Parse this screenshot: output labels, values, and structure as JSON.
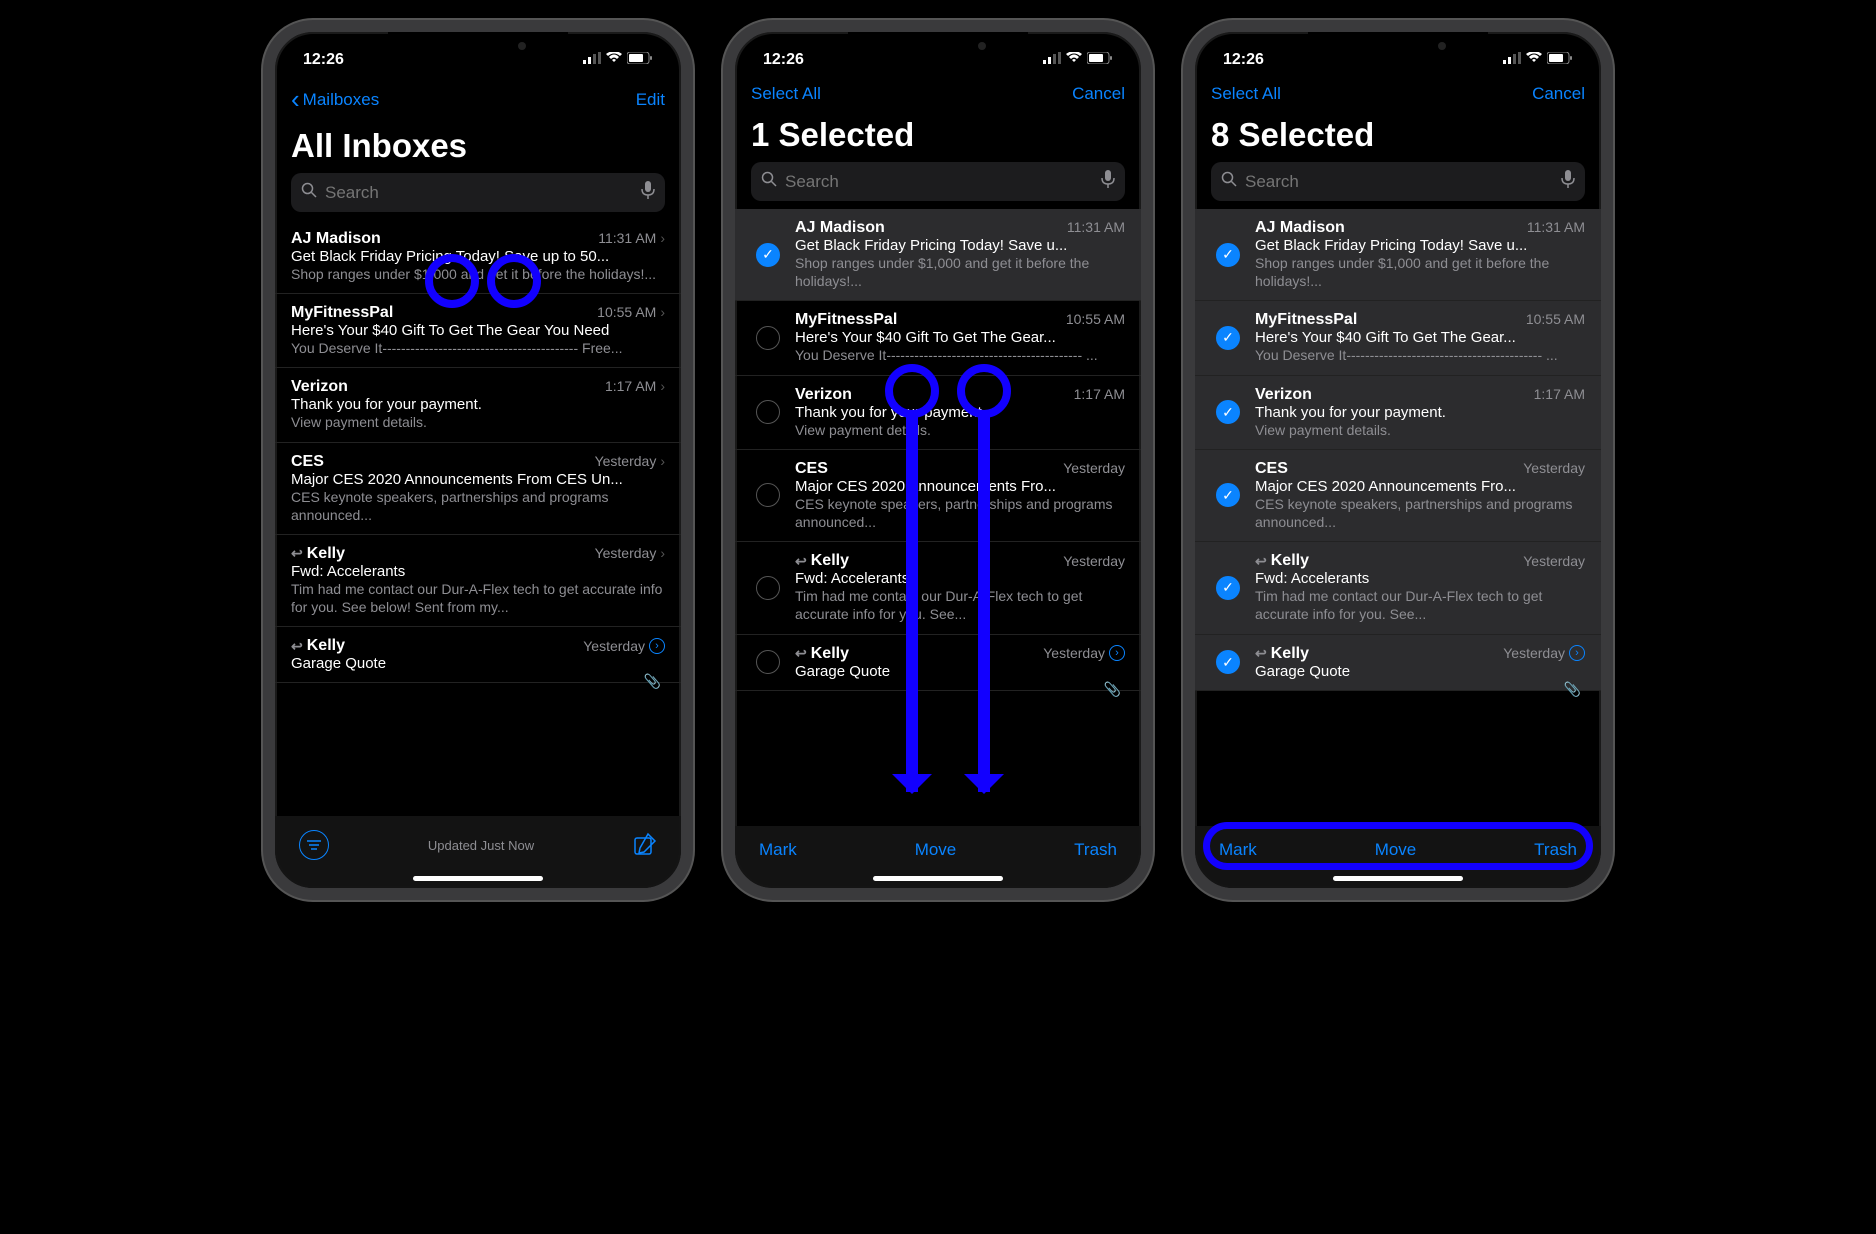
{
  "time": "12:26",
  "screens": [
    {
      "nav": {
        "left_icon": "‹",
        "left_label": "Mailboxes",
        "right_label": "Edit"
      },
      "title": "All Inboxes",
      "search_placeholder": "Search",
      "show_checkboxes": false,
      "rows": [
        {
          "sender": "AJ Madison",
          "time": "11:31 AM",
          "chevron": true,
          "subject": "Get Black Friday Pricing Today! Save up to 50...",
          "preview": "Shop ranges under $1,000 and get it before the holidays!..."
        },
        {
          "sender": "MyFitnessPal",
          "time": "10:55 AM",
          "chevron": true,
          "subject": "Here's Your $40 Gift To Get The Gear You Need",
          "preview": "You Deserve It------------------------------------------ Free..."
        },
        {
          "sender": "Verizon",
          "time": "1:17 AM",
          "chevron": true,
          "subject": "Thank you for your payment.",
          "preview": "View payment details."
        },
        {
          "sender": "CES",
          "time": "Yesterday",
          "chevron": true,
          "subject": "Major CES 2020 Announcements From CES Un...",
          "preview": "CES keynote speakers, partnerships and programs announced..."
        },
        {
          "sender": "Kelly",
          "reply": true,
          "time": "Yesterday",
          "chevron": true,
          "subject": "Fwd: Accelerants",
          "preview": "Tim had me contact our Dur-A-Flex tech to get accurate info for you. See below! Sent from my..."
        },
        {
          "sender": "Kelly",
          "reply": true,
          "time": "Yesterday",
          "thread": true,
          "attach": true,
          "subject": "Garage Quote",
          "preview": ""
        }
      ],
      "toolbar": {
        "type": "status",
        "status_label": "Updated Just Now"
      }
    },
    {
      "nav": {
        "left_label": "Select All",
        "right_label": "Cancel"
      },
      "title": "1 Selected",
      "search_placeholder": "Search",
      "show_checkboxes": true,
      "rows": [
        {
          "checked": true,
          "sender": "AJ Madison",
          "time": "11:31 AM",
          "subject": "Get Black Friday Pricing Today! Save u...",
          "preview": "Shop ranges under $1,000 and get it before the holidays!..."
        },
        {
          "checked": false,
          "sender": "MyFitnessPal",
          "time": "10:55 AM",
          "subject": "Here's Your $40 Gift To Get The Gear...",
          "preview": "You Deserve It------------------------------------------ ..."
        },
        {
          "checked": false,
          "sender": "Verizon",
          "time": "1:17 AM",
          "subject": "Thank you for your payment.",
          "preview": "View payment details."
        },
        {
          "checked": false,
          "sender": "CES",
          "time": "Yesterday",
          "subject": "Major CES 2020 Announcements Fro...",
          "preview": "CES keynote speakers, partnerships and programs announced..."
        },
        {
          "checked": false,
          "sender": "Kelly",
          "reply": true,
          "time": "Yesterday",
          "subject": "Fwd: Accelerants",
          "preview": "Tim had me contact our Dur-A-Flex tech to get accurate info for you. See..."
        },
        {
          "sender": "Kelly",
          "reply": true,
          "time": "Yesterday",
          "thread": true,
          "attach": true,
          "subject": "Garage Quote",
          "preview": ""
        }
      ],
      "toolbar": {
        "type": "actions",
        "left": "Mark",
        "center": "Move",
        "right": "Trash"
      }
    },
    {
      "nav": {
        "left_label": "Select All",
        "right_label": "Cancel"
      },
      "title": "8 Selected",
      "search_placeholder": "Search",
      "show_checkboxes": true,
      "rows": [
        {
          "checked": true,
          "sender": "AJ Madison",
          "time": "11:31 AM",
          "subject": "Get Black Friday Pricing Today! Save u...",
          "preview": "Shop ranges under $1,000 and get it before the holidays!..."
        },
        {
          "checked": true,
          "sender": "MyFitnessPal",
          "time": "10:55 AM",
          "subject": "Here's Your $40 Gift To Get The Gear...",
          "preview": "You Deserve It------------------------------------------ ..."
        },
        {
          "checked": true,
          "sender": "Verizon",
          "time": "1:17 AM",
          "subject": "Thank you for your payment.",
          "preview": "View payment details."
        },
        {
          "checked": true,
          "sender": "CES",
          "time": "Yesterday",
          "subject": "Major CES 2020 Announcements Fro...",
          "preview": "CES keynote speakers, partnerships and programs announced..."
        },
        {
          "checked": true,
          "sender": "Kelly",
          "reply": true,
          "time": "Yesterday",
          "subject": "Fwd: Accelerants",
          "preview": "Tim had me contact our Dur-A-Flex tech to get accurate info for you. See..."
        },
        {
          "checked": true,
          "sender": "Kelly",
          "reply": true,
          "time": "Yesterday",
          "thread": true,
          "attach": true,
          "subject": "Garage Quote",
          "preview": ""
        }
      ],
      "toolbar": {
        "type": "actions",
        "left": "Mark",
        "center": "Move",
        "right": "Trash"
      }
    }
  ]
}
